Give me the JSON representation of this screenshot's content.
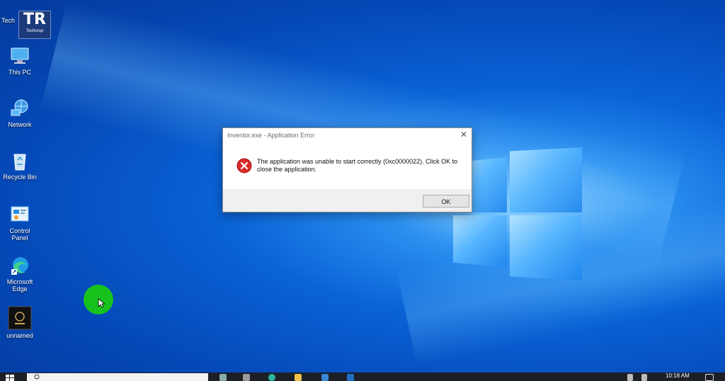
{
  "desktop": {
    "watermark": {
      "big": "TR",
      "small": "Techorup"
    },
    "tech_label": "Tech",
    "icons": [
      {
        "name": "this-pc",
        "label": "This PC"
      },
      {
        "name": "network",
        "label": "Network"
      },
      {
        "name": "recycle-bin",
        "label": "Recycle Bin"
      },
      {
        "name": "control-panel",
        "label": "Control\nPanel"
      },
      {
        "name": "microsoft-edge",
        "label": "Microsoft\nEdge"
      },
      {
        "name": "unnamed",
        "label": "unnamed"
      }
    ]
  },
  "dialog": {
    "title": "Inventor.exe - Application Error",
    "close_glyph": "✕",
    "message": "The application was unable to start correctly (0xc0000022). Click OK to close the application.",
    "ok_label": "OK",
    "icon": "error-icon"
  },
  "taskbar": {
    "clock_time": "10:18 AM"
  },
  "colors": {
    "desktop_blue": "#0a63d6",
    "error_red": "#d92b2b",
    "cursor_highlight": "#18c21d"
  }
}
